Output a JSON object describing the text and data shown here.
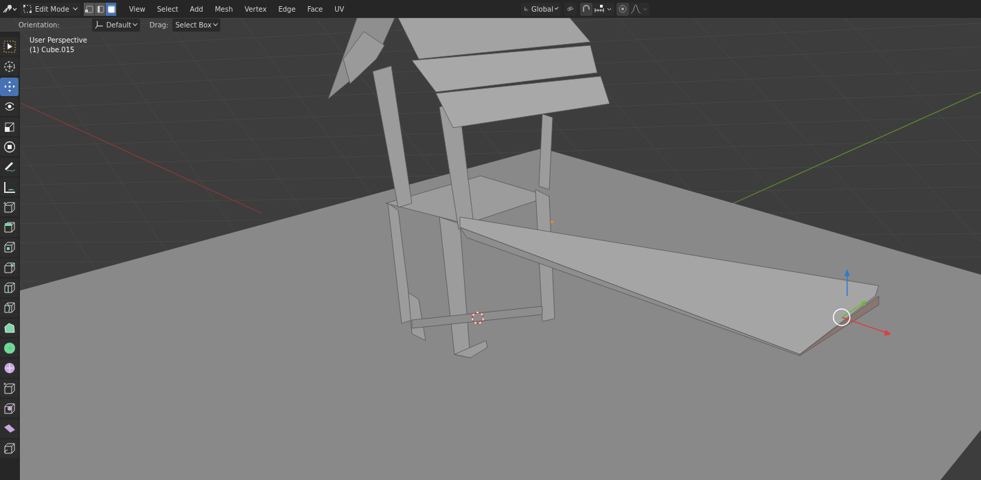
{
  "header": {
    "mode": "Edit Mode",
    "select_modes": [
      {
        "kind": "vertex",
        "selected": false
      },
      {
        "kind": "edge",
        "selected": false
      },
      {
        "kind": "face",
        "selected": true
      }
    ],
    "menus": [
      "View",
      "Select",
      "Add",
      "Mesh",
      "Vertex",
      "Edge",
      "Face",
      "UV"
    ],
    "transform_orientation": "Global"
  },
  "tool_header": {
    "orientation_label": "Orientation:",
    "orientation": "Default",
    "drag_label": "Drag:",
    "drag": "Select Box"
  },
  "viewport": {
    "view_name": "User Perspective",
    "object_name": "(1) Cube.015"
  },
  "toolbar": [
    {
      "kind": "select",
      "selected": false
    },
    {
      "kind": "cursor",
      "selected": false
    },
    {
      "kind": "move",
      "selected": true
    },
    {
      "kind": "rotate",
      "selected": false
    },
    {
      "kind": "scale",
      "selected": false
    },
    {
      "kind": "transform",
      "selected": false
    },
    {
      "kind": "annotate",
      "selected": false
    },
    {
      "kind": "measure",
      "selected": false
    },
    {
      "kind": "add_cube",
      "selected": false
    },
    {
      "kind": "extrude",
      "selected": false
    },
    {
      "kind": "inset",
      "selected": false
    },
    {
      "kind": "bevel",
      "selected": false
    },
    {
      "kind": "loop_cut",
      "selected": false
    },
    {
      "kind": "knife",
      "selected": false
    },
    {
      "kind": "poly_build",
      "selected": false
    },
    {
      "kind": "spin",
      "selected": false
    },
    {
      "kind": "smooth",
      "selected": false
    },
    {
      "kind": "edge_slide",
      "selected": false
    },
    {
      "kind": "shrink",
      "selected": false
    },
    {
      "kind": "shear",
      "selected": false
    },
    {
      "kind": "rip",
      "selected": false
    }
  ]
}
